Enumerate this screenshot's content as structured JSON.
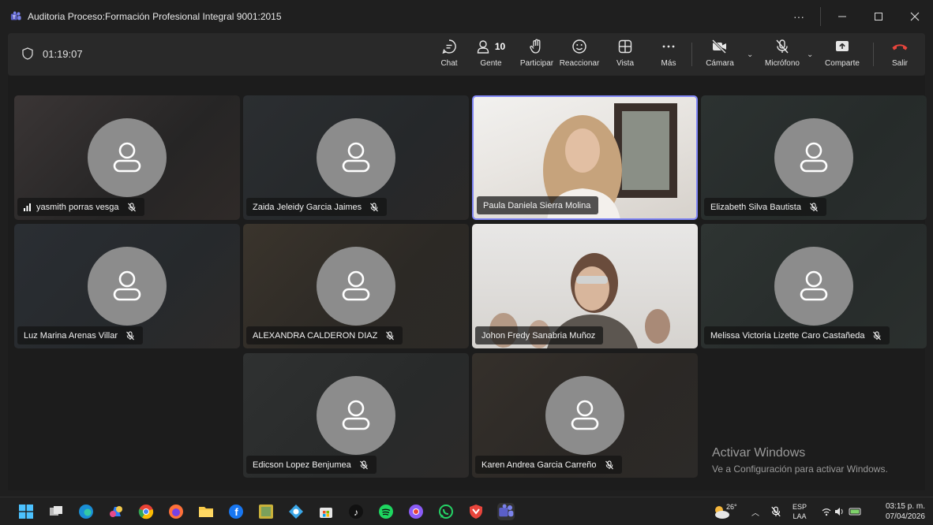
{
  "window": {
    "title": "Auditoria Proceso:Formación Profesional Integral 9001:2015",
    "more": "···"
  },
  "meeting": {
    "timer": "01:19:07",
    "people_count": "10"
  },
  "toolbar": {
    "chat": "Chat",
    "people": "Gente",
    "participate": "Participar",
    "react": "Reaccionar",
    "view": "Vista",
    "more": "Más",
    "camera": "Cámara",
    "mic": "Micrófono",
    "share": "Comparte",
    "leave": "Salir"
  },
  "participants": [
    {
      "name": "yasmith porras vesga",
      "muted": true,
      "video": false,
      "signal": true
    },
    {
      "name": "Zaida Jeleidy Garcia Jaimes",
      "muted": true,
      "video": false
    },
    {
      "name": "Paula Daniela Sierra Molina",
      "muted": false,
      "video": true
    },
    {
      "name": "Elizabeth Silva Bautista",
      "muted": true,
      "video": false
    },
    {
      "name": "Luz Marina Arenas Villar",
      "muted": true,
      "video": false
    },
    {
      "name": "ALEXANDRA CALDERON DIAZ",
      "muted": true,
      "video": false
    },
    {
      "name": "Johon Fredy Sanabria Muñoz",
      "muted": false,
      "video": true
    },
    {
      "name": "Melissa Victoria Lizette Caro Castañeda",
      "muted": true,
      "video": false
    },
    {
      "name": "Edicson Lopez Benjumea",
      "muted": true,
      "video": false
    },
    {
      "name": "Karen Andrea Garcia Carreño",
      "muted": true,
      "video": false
    }
  ],
  "watermark": {
    "line1": "Activar Windows",
    "line2": "Ve a Configuración para activar Windows."
  },
  "taskbar": {
    "weather": "26°",
    "lang1": "ESP",
    "lang2": "LAA",
    "time": "03:15 p. m.",
    "date": "07/04/2026"
  },
  "colors": {
    "accent": "#7f85f5",
    "leave": "#e8453c",
    "avatar": "#8c8c8c"
  }
}
